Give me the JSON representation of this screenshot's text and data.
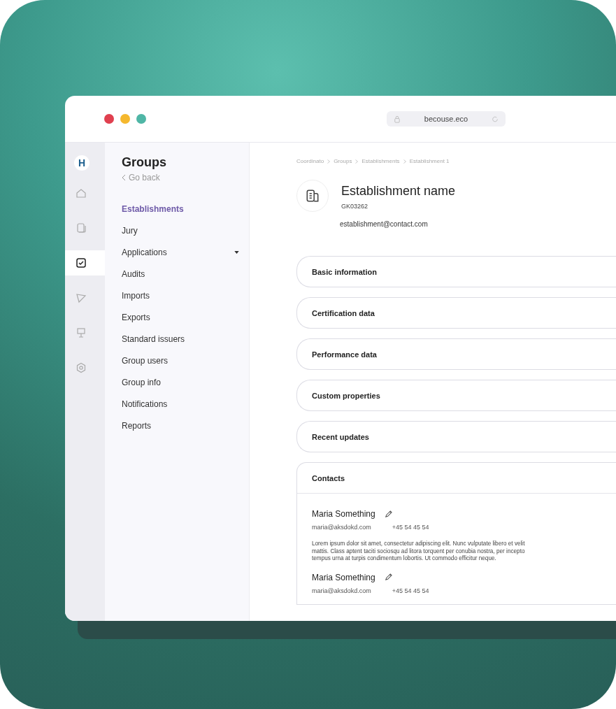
{
  "browser": {
    "address": "becouse.eco"
  },
  "rail": {
    "logo": "H",
    "items": [
      {
        "kind": "home",
        "selected": false
      },
      {
        "kind": "documents",
        "selected": false
      },
      {
        "kind": "checkbox",
        "selected": true
      },
      {
        "kind": "send",
        "selected": false
      },
      {
        "kind": "board",
        "selected": false
      },
      {
        "kind": "settings",
        "selected": false
      }
    ]
  },
  "sidebar": {
    "title": "Groups",
    "back": "Go back",
    "items": [
      {
        "label": "Establishments",
        "selected": true,
        "has_submenu": false
      },
      {
        "label": "Jury",
        "selected": false,
        "has_submenu": false
      },
      {
        "label": "Applications",
        "selected": false,
        "has_submenu": true
      },
      {
        "label": "Audits",
        "selected": false,
        "has_submenu": false
      },
      {
        "label": "Imports",
        "selected": false,
        "has_submenu": false
      },
      {
        "label": "Exports",
        "selected": false,
        "has_submenu": false
      },
      {
        "label": "Standard issuers",
        "selected": false,
        "has_submenu": false
      },
      {
        "label": "Group users",
        "selected": false,
        "has_submenu": false
      },
      {
        "label": "Group info",
        "selected": false,
        "has_submenu": false
      },
      {
        "label": "Notifications",
        "selected": false,
        "has_submenu": false
      },
      {
        "label": "Reports",
        "selected": false,
        "has_submenu": false
      }
    ]
  },
  "breadcrumb": [
    "Coordinato",
    "Groups",
    "Establishments",
    "Establishment 1"
  ],
  "establishment": {
    "name": "Establishment name",
    "code": "GK03262",
    "email": "establishment@contact.com"
  },
  "sections": [
    {
      "title": "Basic information",
      "expanded": false
    },
    {
      "title": "Certification data",
      "expanded": false
    },
    {
      "title": "Performance data",
      "expanded": false
    },
    {
      "title": "Custom properties",
      "expanded": false
    },
    {
      "title": "Recent updates",
      "expanded": false
    },
    {
      "title": "Contacts",
      "expanded": true
    }
  ],
  "contacts": [
    {
      "name": "Maria Something",
      "email": "maria@aksdokd.com",
      "phone": "+45 54 45 54",
      "note_lines": [
        "Lorem ipsum dolor sit amet, consectetur adipiscing elit. Nunc vulputate libero et velit",
        "mattis. Class aptent taciti sociosqu ad litora torquent per conubia nostra, per incepto",
        "tempus urna at turpis condimentum lobortis. Ut commodo efficitur neque."
      ]
    },
    {
      "name": "Maria Something",
      "email": "maria@aksdokd.com",
      "phone": "+45 54 45 54"
    }
  ]
}
